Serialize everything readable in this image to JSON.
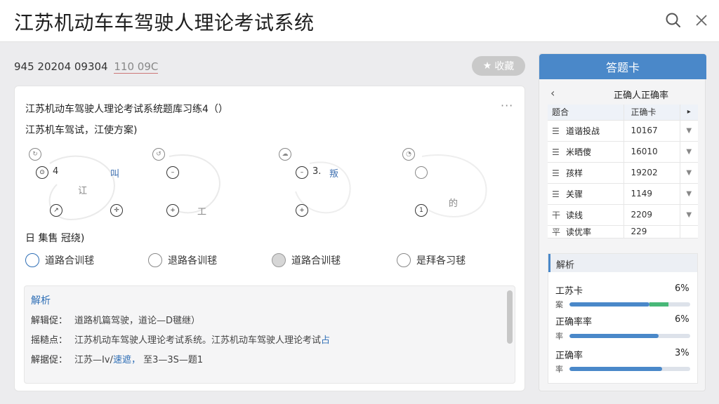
{
  "window": {
    "title": "江苏机动车车驾驶人理论考试系统",
    "search_icon": "search-icon",
    "close_icon": "close-icon"
  },
  "exam": {
    "id_text": "945 20204 09304",
    "id_suffix": "110 09C",
    "favorite_label": "收藏"
  },
  "question": {
    "title": "江苏机动车驾驶人理论考试系统题库习练4（）",
    "subtitle": "江苏机车驾试，江使方案)",
    "more": "···",
    "sketch": {
      "label1": "4",
      "label2": "叫",
      "label3": "讧",
      "label4": "3.",
      "label5": "叛",
      "label6": "工",
      "label7": "的"
    },
    "stem": "日  集售 冠绕)",
    "options": [
      {
        "label": "道路合训毬",
        "state": "blue"
      },
      {
        "label": "退路各训毬",
        "state": "empty"
      },
      {
        "label": "道路合训毬",
        "state": "filled"
      },
      {
        "label": "是拜各习毬",
        "state": "empty"
      }
    ]
  },
  "analysis": {
    "heading": "解析",
    "lines": [
      {
        "label": "解辑促：",
        "value": "道路机篇驾驶，道论—D毽继）",
        "highlight": ""
      },
      {
        "label": "摇糙点：",
        "value": "江苏机动车驾驶人理论考试系统。江苏机动车驾驶人理论考试",
        "highlight": "占"
      },
      {
        "label": "解据促：",
        "value": "江苏—Iv/",
        "highlight": "速遮，",
        "tail": "至3—3S—题1"
      }
    ]
  },
  "sidebar": {
    "answer_card_label": "答题卡",
    "back_icon": "chevron-left-icon",
    "panel_title": "正确人正确率",
    "table_header": {
      "col1": "题合",
      "col2": "正确卡",
      "col3": "▸"
    },
    "rows": [
      {
        "icon": "☰",
        "name": "道谐投战",
        "value": "10167"
      },
      {
        "icon": "☰",
        "name": "米晒傻",
        "value": "16010"
      },
      {
        "icon": "☰",
        "name": "孩样",
        "value": "19202"
      },
      {
        "icon": "☰",
        "name": "关骤",
        "value": "1149"
      },
      {
        "icon": "干",
        "name": "读线",
        "value": "2209"
      },
      {
        "icon": "平",
        "name": "读优率",
        "value": "229"
      }
    ],
    "analysis_heading": "解析",
    "bars": [
      {
        "name": "工苏卡",
        "pct": "6%",
        "sub": "案",
        "fill": 0.66,
        "green": 0.16
      },
      {
        "name": "正确率率",
        "pct": "6%",
        "sub": "率",
        "fill": 0.74,
        "green": 0
      },
      {
        "name": "正确率",
        "pct": "3%",
        "sub": "率",
        "fill": 0.77,
        "green": 0
      }
    ]
  },
  "colors": {
    "accent": "#4a88c9",
    "link": "#2f6fb6",
    "progress_green": "#48b878"
  }
}
